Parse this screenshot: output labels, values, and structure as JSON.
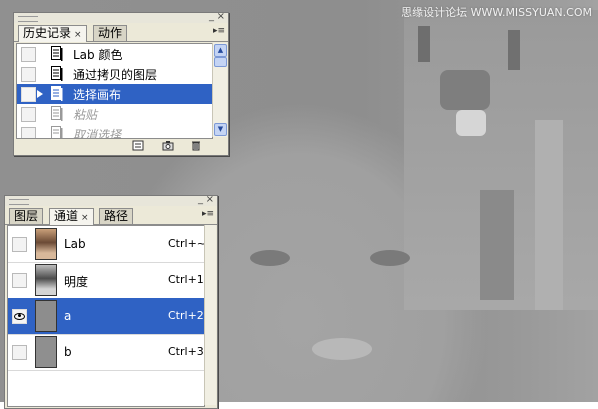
{
  "watermark": "思缘设计论坛  WWW.MISSYUAN.COM",
  "history_panel": {
    "tabs": [
      {
        "label": "历史记录",
        "active": true,
        "close": "×"
      },
      {
        "label": "动作",
        "active": false
      }
    ],
    "window_buttons": {
      "minimize": "_",
      "close": "×"
    },
    "menu_icon": "▸≡",
    "items": [
      {
        "label": "Lab 颜色",
        "state": "normal"
      },
      {
        "label": "通过拷贝的图层",
        "state": "normal"
      },
      {
        "label": "选择画布",
        "state": "selected"
      },
      {
        "label": "粘贴",
        "state": "dimmed"
      },
      {
        "label": "取消选择",
        "state": "dimmed"
      }
    ],
    "footer_icons": [
      "new-document-from-state-icon",
      "snapshot-camera-icon",
      "trash-icon"
    ]
  },
  "channels_panel": {
    "tabs": [
      {
        "label": "图层",
        "active": false
      },
      {
        "label": "通道",
        "active": true,
        "close": "×"
      },
      {
        "label": "路径",
        "active": false
      }
    ],
    "window_buttons": {
      "minimize": "_",
      "close": "×"
    },
    "menu_icon": "▸≡",
    "channels": [
      {
        "name": "Lab",
        "shortcut": "Ctrl+~",
        "visible": false,
        "selected": false,
        "thumb": "color"
      },
      {
        "name": "明度",
        "shortcut": "Ctrl+1",
        "visible": false,
        "selected": false,
        "thumb": "gray"
      },
      {
        "name": "a",
        "shortcut": "Ctrl+2",
        "visible": true,
        "selected": true,
        "thumb": "flat"
      },
      {
        "name": "b",
        "shortcut": "Ctrl+3",
        "visible": false,
        "selected": false,
        "thumb": "flat"
      }
    ]
  },
  "colors": {
    "selection": "#2f62c4",
    "panel_bg": "#ece9d8"
  }
}
